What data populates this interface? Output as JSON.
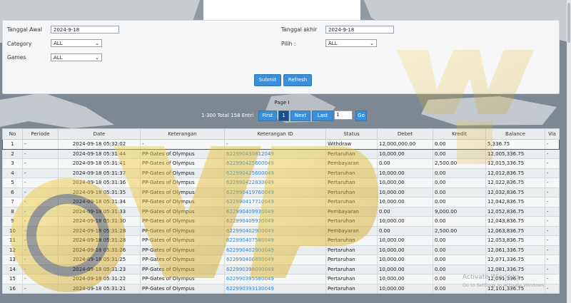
{
  "filters": {
    "tanggal_awal_label": "Tanggal Awal",
    "tanggal_awal_value": "2024-9-18",
    "tanggal_akhir_label": "Tanggal akhir",
    "tanggal_akhir_value": "2024-9-18",
    "category_label": "Category",
    "category_value": "ALL",
    "pilih_label": "Pilih :",
    "pilih_value": "ALL",
    "games_label": "Games",
    "games_value": "ALL",
    "submit_label": "Submit",
    "refresh_label": "Refresh"
  },
  "pager": {
    "page_label": "Page I",
    "total_label": "1-300 Total 158 Entri",
    "first_label": "First",
    "current_page": "1",
    "next_label": "Next",
    "last_label": "Last",
    "page_input_value": "1",
    "go_label": "Go"
  },
  "table": {
    "headers": [
      "No",
      "Periode",
      "Date",
      "Keterangan",
      "Keterangan ID",
      "Status",
      "Debet",
      "Kredit",
      "Balance",
      "Via"
    ],
    "rows": [
      [
        "1",
        "-",
        "2024-09-18 05:32:02",
        "-",
        "-",
        "Withdraw",
        "12,000,000.00",
        "0.00",
        "5,336.75",
        "-"
      ],
      [
        "2",
        "-",
        "2024-09-18 05:31:44",
        "PP-Gates of Olympus",
        "622990430812049",
        "Pertaruhan",
        "10,000.00",
        "0.00",
        "12,005,336.75",
        "-"
      ],
      [
        "3",
        "-",
        "2024-09-18 05:31:41",
        "PP-Gates of Olympus",
        "622990425600049",
        "Pembayaran",
        "0.00",
        "2,500.00",
        "12,015,336.75",
        "-"
      ],
      [
        "4",
        "-",
        "2024-09-18 05:31:37",
        "PP-Gates of Olympus",
        "622990425600049",
        "Pertaruhan",
        "10,000.00",
        "0.00",
        "12,012,836.75",
        "-"
      ],
      [
        "5",
        "-",
        "2024-09-18 05:31:36",
        "PP-Gates of Olympus",
        "622990422830049",
        "Pertaruhan",
        "10,000.00",
        "0.00",
        "12,022,836.75",
        "-"
      ],
      [
        "6",
        "-",
        "2024-09-18 05:31:35",
        "PP-Gates of Olympus",
        "622990419760049",
        "Pertaruhan",
        "10,000.00",
        "0.00",
        "12,032,836.75",
        "-"
      ],
      [
        "7",
        "-",
        "2024-09-18 05:31:34",
        "PP-Gates of Olympus",
        "622990417710049",
        "Pertaruhan",
        "10,000.00",
        "0.00",
        "12,042,836.75",
        "-"
      ],
      [
        "8",
        "-",
        "2024-09-18 05:31:33",
        "PP-Gates of Olympus",
        "622990409930049",
        "Pembayaran",
        "0.00",
        "9,000.00",
        "12,052,836.75",
        "-"
      ],
      [
        "9",
        "-",
        "2024-09-18 05:31:30",
        "PP-Gates of Olympus",
        "622990409930049",
        "Pertaruhan",
        "10,000.00",
        "0.00",
        "12,043,836.75",
        "-"
      ],
      [
        "10",
        "-",
        "2024-09-18 05:31:28",
        "PP-Gates of Olympus",
        "622990402900049",
        "Pembayaran",
        "0.00",
        "2,500.00",
        "12,063,836.75",
        "-"
      ],
      [
        "11",
        "-",
        "2024-09-18 05:31:28",
        "PP-Gates of Olympus",
        "622990407580049",
        "Pertaruhan",
        "10,000.00",
        "0.00",
        "12,053,836.75",
        "-"
      ],
      [
        "12",
        "-",
        "2024-09-18 05:31:26",
        "PP-Gates of Olympus",
        "622990402900049",
        "Pertaruhan",
        "10,000.00",
        "0.00",
        "12,061,336.75",
        "-"
      ],
      [
        "13",
        "-",
        "2024-09-18 05:31:25",
        "PP-Gates of Olympus",
        "622990400890049",
        "Pertaruhan",
        "10,000.00",
        "0.00",
        "12,071,336.75",
        "-"
      ],
      [
        "14",
        "-",
        "2024-09-18 05:31:23",
        "PP-Gates of Olympus",
        "622990398090049",
        "Pertaruhan",
        "10,000.00",
        "0.00",
        "12,081,336.75",
        "-"
      ],
      [
        "15",
        "-",
        "2024-09-18 05:31:22",
        "PP-Gates of Olympus",
        "622990395580049",
        "Pertaruhan",
        "10,000.00",
        "0.00",
        "12,091,336.75",
        "-"
      ],
      [
        "16",
        "-",
        "2024-09-18 05:31:21",
        "PP-Gates of Olympus",
        "622990393130049",
        "Pertaruhan",
        "10,000.00",
        "0.00",
        "12,101,336.75",
        "-"
      ]
    ],
    "highlight_row_index": 0,
    "highlight_color": "#d8232a"
  },
  "overlay": {
    "activate_title": "Activate Windows",
    "activate_sub": "Go to Settings to activate Windows."
  },
  "colors": {
    "button_blue": "#3b8fd9",
    "link_blue": "#3a86c8"
  }
}
